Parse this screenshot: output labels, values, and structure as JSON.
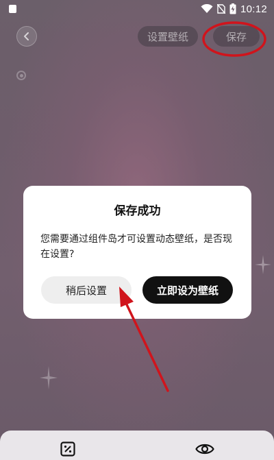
{
  "status_bar": {
    "time": "10:12",
    "icons": [
      "notification-square-icon",
      "wifi-icon",
      "no-sim-icon",
      "battery-charging-icon"
    ]
  },
  "header": {
    "back_icon": "chevron-left-icon",
    "set_wallpaper_label": "设置壁纸",
    "save_label": "保存"
  },
  "dialog": {
    "title": "保存成功",
    "message": "您需要通过组件岛才可设置动态壁纸，是否现在设置?",
    "later_label": "稍后设置",
    "set_now_label": "立即设为壁纸"
  },
  "bottom_bar": {
    "icons": [
      "percent-box-icon",
      "eye-icon"
    ]
  },
  "colors": {
    "background": "#6e5d6b",
    "dialog_background": "#ffffff",
    "primary_button": "#111111",
    "secondary_button": "#eeeeee",
    "annotation_red": "#d0141c"
  }
}
